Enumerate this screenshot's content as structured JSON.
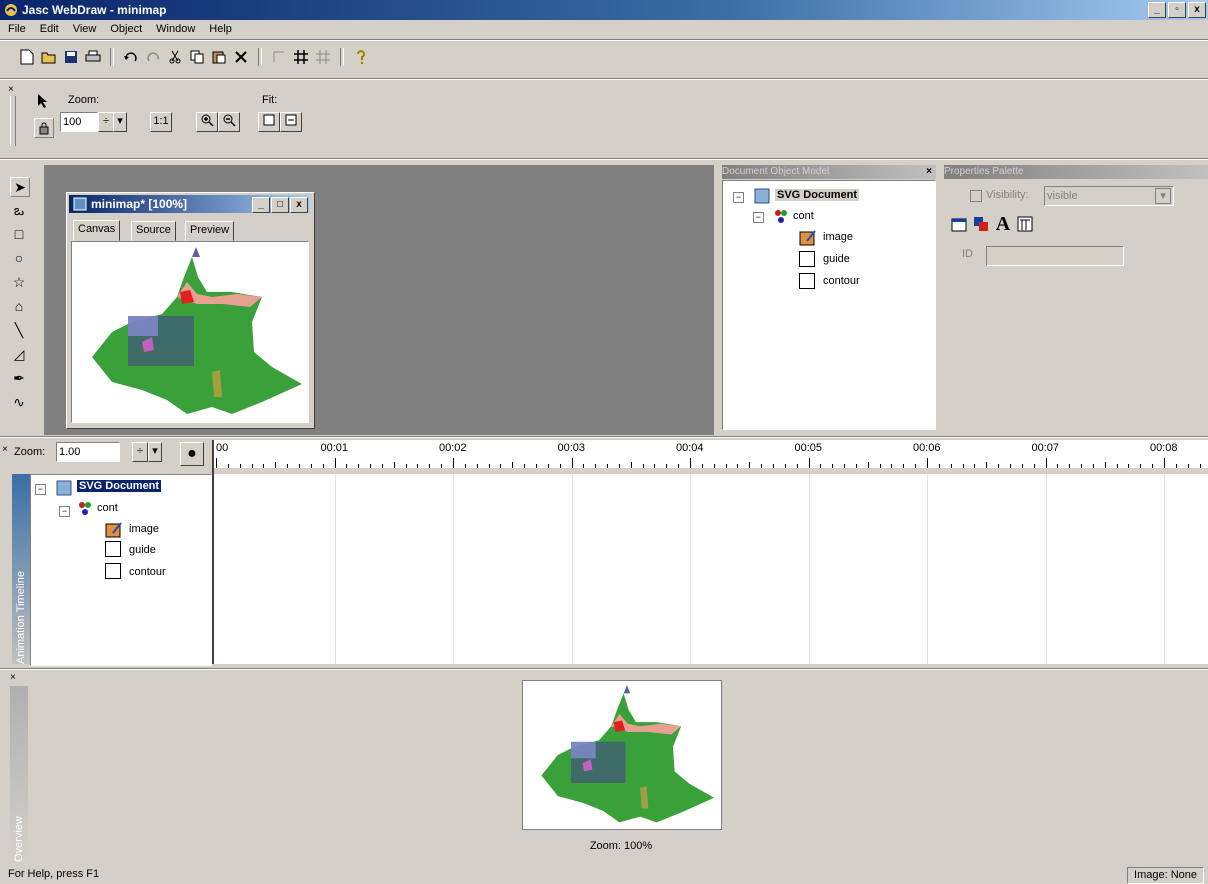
{
  "window": {
    "title": "Jasc WebDraw - minimap",
    "min": "_",
    "restore": "▫",
    "close": "x"
  },
  "menu": [
    "File",
    "Edit",
    "View",
    "Object",
    "Window",
    "Help"
  ],
  "toolbar2": {
    "zoom_label": "Zoom:",
    "zoom_value": "100",
    "one_to_one": "1:1",
    "fit_label": "Fit:"
  },
  "doc_window": {
    "title": "minimap* [100%]",
    "tabs": [
      "Canvas",
      "Source",
      "Preview"
    ]
  },
  "dom_panel": {
    "title": "Document Object Model",
    "root": "SVG Document",
    "group": "cont",
    "children": [
      "image",
      "guide",
      "contour"
    ]
  },
  "props_panel": {
    "title": "Properties Palette",
    "visibility_label": "Visibility:",
    "visibility_value": "visible",
    "id_label": "ID"
  },
  "timeline": {
    "side_label": "Animation Timeline",
    "zoom_label": "Zoom:",
    "zoom_value": "1.00",
    "ruler": [
      "00",
      "00:01",
      "00:02",
      "00:03",
      "00:04",
      "00:05",
      "00:06",
      "00:07",
      "00:08"
    ],
    "tree": {
      "root": "SVG Document",
      "group": "cont",
      "children": [
        "image",
        "guide",
        "contour"
      ]
    }
  },
  "overview": {
    "side_label": "Overview",
    "zoom_text": "Zoom: 100%"
  },
  "status": {
    "help": "For Help, press F1",
    "image": "Image: None"
  }
}
